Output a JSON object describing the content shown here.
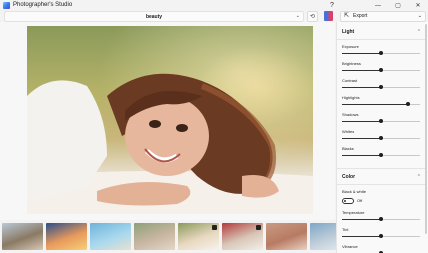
{
  "app": {
    "title": "Photographer's Studio"
  },
  "window_controls": {
    "help": "?",
    "minimize": "—",
    "maximize": "▢",
    "close": "✕"
  },
  "toolbar": {
    "filename": "beauty",
    "history_icon": "history-icon",
    "export_label": "Export",
    "export_icon": "export-icon"
  },
  "panel": {
    "light": {
      "title": "Light",
      "sliders": [
        {
          "label": "Exposure",
          "value": 0.5
        },
        {
          "label": "Brightness",
          "value": 0.5
        },
        {
          "label": "Contrast",
          "value": 0.5
        },
        {
          "label": "Highlights",
          "value": 0.85
        },
        {
          "label": "Shadows",
          "value": 0.5
        },
        {
          "label": "Whites",
          "value": 0.5
        },
        {
          "label": "Blacks",
          "value": 0.5
        }
      ]
    },
    "color": {
      "title": "Color",
      "bw_label": "Black & white",
      "bw_state": "Off",
      "sliders": [
        {
          "label": "Temperature",
          "value": 0.5
        },
        {
          "label": "Tint",
          "value": 0.5
        },
        {
          "label": "Vibrance",
          "value": 0.5
        }
      ]
    }
  },
  "filmstrip": {
    "thumbs": [
      {
        "name": "thumb-woman-field",
        "colors": [
          "#b9c9d6",
          "#8a7a64",
          "#d9c8b4"
        ]
      },
      {
        "name": "thumb-sunset-sea",
        "colors": [
          "#2a4f8a",
          "#e89a5c",
          "#f6d07a"
        ]
      },
      {
        "name": "thumb-beach-palm",
        "colors": [
          "#6fb3d9",
          "#a9d8ee",
          "#e7e1cf"
        ]
      },
      {
        "name": "thumb-flowers-woman",
        "colors": [
          "#8ea07a",
          "#c9b6a2",
          "#e3d8ca"
        ]
      },
      {
        "name": "thumb-beauty-selected",
        "colors": [
          "#8a9a5a",
          "#e8d8c0",
          "#f6f3ec"
        ],
        "badge": true
      },
      {
        "name": "thumb-portrait-red",
        "colors": [
          "#b13b3b",
          "#d8c7b7",
          "#f3efe9"
        ],
        "badge": true
      },
      {
        "name": "thumb-woman-hat",
        "colors": [
          "#c99a82",
          "#b87b63",
          "#e9d2c2"
        ]
      },
      {
        "name": "thumb-woman-sky",
        "colors": [
          "#7ea6c6",
          "#c2cfda",
          "#e7eef3"
        ]
      }
    ]
  }
}
